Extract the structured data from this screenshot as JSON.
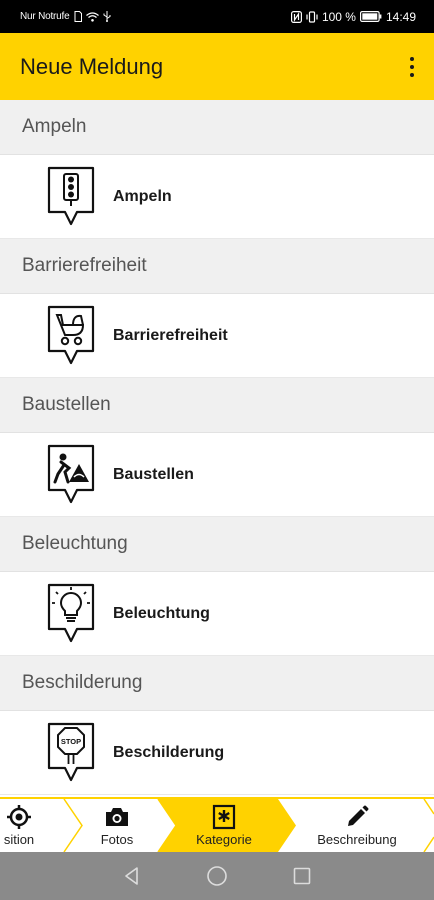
{
  "status_bar": {
    "left_text": "Nur Notrufe",
    "battery_text": "100 %",
    "time": "14:49",
    "icons": [
      "sim-icon",
      "wifi-icon",
      "usb-icon",
      "nfc-icon",
      "vibrate-icon",
      "battery-icon"
    ]
  },
  "app_bar": {
    "title": "Neue Meldung",
    "menu_icon": "overflow-menu-icon"
  },
  "categories": [
    {
      "header": "Ampeln",
      "label": "Ampeln",
      "icon": "traffic-light-icon"
    },
    {
      "header": "Barrierefreiheit",
      "label": "Barrierefreiheit",
      "icon": "stroller-icon"
    },
    {
      "header": "Baustellen",
      "label": "Baustellen",
      "icon": "construction-icon"
    },
    {
      "header": "Beleuchtung",
      "label": "Beleuchtung",
      "icon": "lightbulb-icon"
    },
    {
      "header": "Beschilderung",
      "label": "Beschilderung",
      "icon": "stop-sign-icon"
    }
  ],
  "steps": [
    {
      "label": "sition",
      "icon": "location-target-icon",
      "active": false
    },
    {
      "label": "Fotos",
      "icon": "camera-icon",
      "active": false
    },
    {
      "label": "Kategorie",
      "icon": "category-asterisk-icon",
      "active": true
    },
    {
      "label": "Beschreibung",
      "icon": "pencil-icon",
      "active": false
    }
  ],
  "colors": {
    "accent": "#ffd200",
    "section_bg": "#f0f0f0",
    "nav_bar": "#8a8a8a"
  }
}
